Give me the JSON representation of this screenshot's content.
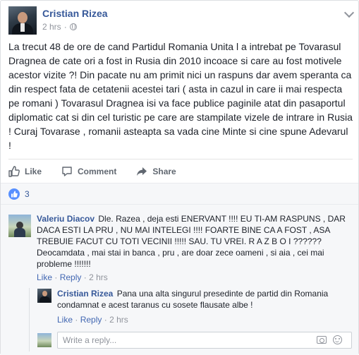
{
  "post": {
    "author": "Cristian Rizea",
    "time": "2 hrs",
    "privacy_icon": "globe-icon",
    "text": "La trecut 48 de ore de cand Partidul Romania Unita l a intrebat pe Tovarasul Dragnea de cate ori a fost in Rusia din 2010 incoace si care au fost motivele acestor vizite ?! Din pacate nu am primit nici un raspuns dar avem speranta ca din respect fata de cetatenii acestei tari ( asta in cazul in care ii mai respecta pe romani ) Tovarasul Dragnea isi va face publice paginile atat din pasaportul diplomatic cat si din cel turistic pe care are stampilate vizele de intrare in Rusia ! Curaj Tovarase , romanii asteapta sa vada cine Minte si cine spune Adevarul !"
  },
  "actions": {
    "like": "Like",
    "comment": "Comment",
    "share": "Share"
  },
  "reactions": {
    "count": "3"
  },
  "comments": [
    {
      "author": "Valeriu Diacov",
      "text": "Dle. Razea , deja esti ENERVANT !!!! EU TI-AM RASPUNS , DAR DACA ESTI LA PRU , NU MAI INTELEGI !!!! FOARTE BINE CA A FOST , ASA TREBUIE FACUT CU TOTI VECINII !!!!! SAU. TU VREI. R A Z B O I ?????? Deocamdata , mai stai in banca , pru , are doar zece oameni , si aia , cei mai probleme !!!!!!!",
      "like": "Like",
      "reply": "Reply",
      "time": "2 hrs"
    },
    {
      "author": "Cristian Rizea",
      "text": "Pana una alta singurul presedinte de partid din Romania condamnat e acest taranus cu sosete flausate albe !",
      "like": "Like",
      "reply": "Reply",
      "time": "2 hrs"
    }
  ],
  "reply_box": {
    "placeholder": "Write a reply..."
  },
  "colors": {
    "link": "#365899",
    "meta": "#90949c",
    "like_badge": "#5890ff"
  }
}
